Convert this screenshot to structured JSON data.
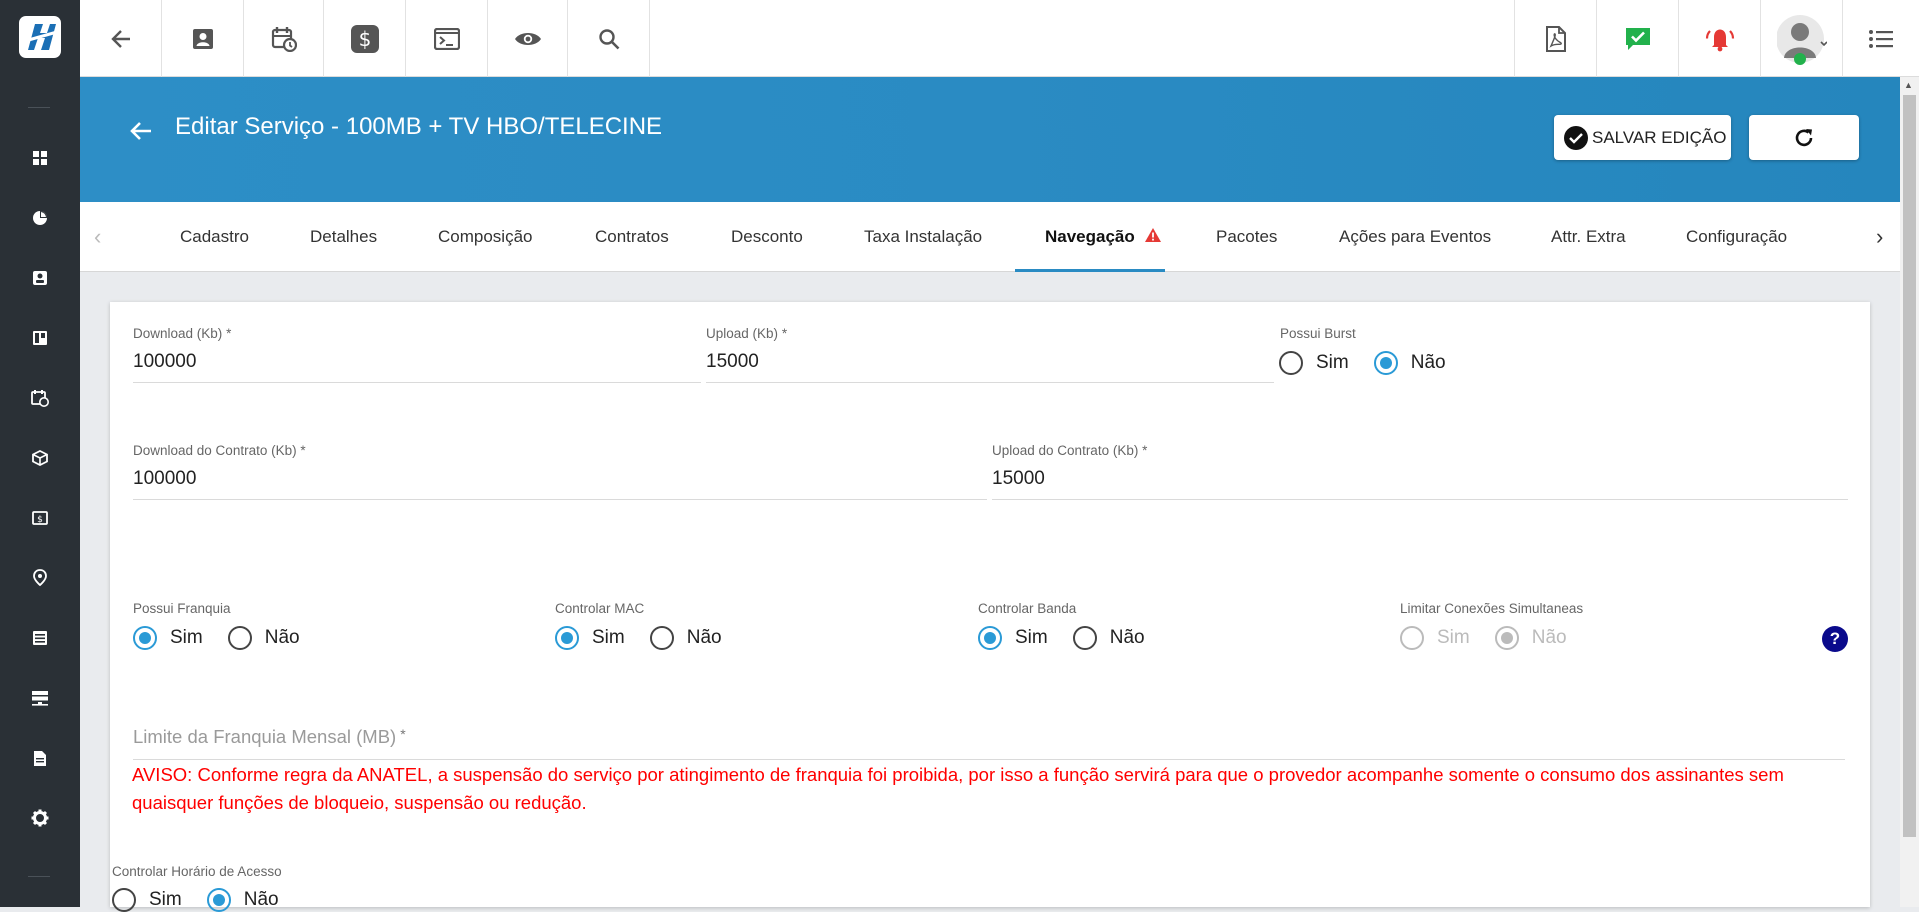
{
  "header": {
    "title": "Editar Serviço - 100MB + TV HBO/TELECINE",
    "save_label": "SALVAR EDIÇÃO"
  },
  "tabs": [
    {
      "label": "Cadastro"
    },
    {
      "label": "Detalhes"
    },
    {
      "label": "Composição"
    },
    {
      "label": "Contratos"
    },
    {
      "label": "Desconto"
    },
    {
      "label": "Taxa Instalação"
    },
    {
      "label": "Navegação",
      "active": true,
      "warning": true
    },
    {
      "label": "Pacotes"
    },
    {
      "label": "Ações para Eventos"
    },
    {
      "label": "Attr. Extra"
    },
    {
      "label": "Configuração"
    }
  ],
  "form": {
    "download": {
      "label": "Download (Kb)",
      "required": "*",
      "value": "100000"
    },
    "upload": {
      "label": "Upload (Kb)",
      "required": "*",
      "value": "15000"
    },
    "possui_burst": {
      "label": "Possui Burst",
      "selected": "Não"
    },
    "download_contrato": {
      "label": "Download do Contrato (Kb)",
      "required": "*",
      "value": "100000"
    },
    "upload_contrato": {
      "label": "Upload do Contrato (Kb)",
      "required": "*",
      "value": "15000"
    },
    "possui_franquia": {
      "label": "Possui Franquia",
      "selected": "Sim"
    },
    "controlar_mac": {
      "label": "Controlar MAC",
      "selected": "Sim"
    },
    "controlar_banda": {
      "label": "Controlar Banda",
      "selected": "Sim"
    },
    "limitar_conexoes": {
      "label": "Limitar Conexões Simultaneas",
      "selected": "Não",
      "disabled": true
    },
    "limite_franquia": {
      "label": "Limite da Franquia Mensal (MB)",
      "required": "*",
      "value": ""
    },
    "aviso": "AVISO: Conforme regra da ANATEL, a suspensão do serviço por atingimento de franquia foi proibida, por isso a função servirá para que o provedor acompanhe somente o consumo dos assinantes sem quaisquer funções de bloqueio, suspensão ou redução.",
    "controlar_horario": {
      "label": "Controlar Horário de Acesso",
      "selected": "Não"
    },
    "opt_sim": "Sim",
    "opt_nao": "Não",
    "help": "?"
  },
  "colors": {
    "header": "#2a8bc3",
    "sidebar": "#2a3036",
    "accent": "#2a9ad6",
    "warning": "#ff0000",
    "notify_green": "#22b14c",
    "alarm_red": "#e53935"
  },
  "icons": {
    "sidebar": [
      "dashboard-icon",
      "pie-chart-icon",
      "contact-card-icon",
      "kanban-icon",
      "calendar-clock-icon",
      "package-icon",
      "money-icon",
      "map-pin-icon",
      "list-icon",
      "server-icon",
      "document-icon",
      "gear-icon"
    ],
    "toolbar": [
      "back-arrow-icon",
      "contact-card-icon",
      "calendar-clock-icon",
      "dollar-icon",
      "terminal-icon",
      "eye-icon",
      "search-icon",
      "pdf-icon",
      "check-message-icon",
      "alarm-icon",
      "avatar",
      "menu-list-icon"
    ]
  }
}
